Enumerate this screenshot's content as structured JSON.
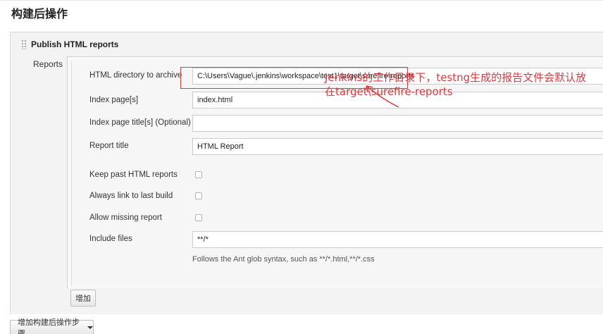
{
  "section": {
    "title": "构建后操作"
  },
  "step": {
    "title": "Publish HTML reports",
    "reports_label": "Reports"
  },
  "fields": {
    "html_dir": {
      "label": "HTML directory to archive",
      "value": "C:\\Users\\Vague\\.jenkins\\workspace\\test1\\target\\surefire-reports"
    },
    "index_pages": {
      "label": "Index page[s]",
      "value": "index.html"
    },
    "index_titles": {
      "label": "Index page title[s] (Optional)",
      "value": ""
    },
    "report_title": {
      "label": "Report title",
      "value": "HTML Report"
    },
    "keep_past": {
      "label": "Keep past HTML reports",
      "checked": false
    },
    "always_link": {
      "label": "Always link to last build",
      "checked": false
    },
    "allow_missing": {
      "label": "Allow missing report",
      "checked": false
    },
    "include_files": {
      "label": "Include files",
      "value": "**/*",
      "help": "Follows the Ant glob syntax, such as **/*.html,**/*.css"
    }
  },
  "annotation": {
    "line1": "Jenkins的工作目录下，testng生成的报告文件会默认放",
    "line2": "在target\\surefire-reports",
    "color": "#e0393e"
  },
  "buttons": {
    "add": "增加",
    "add_post_build_step": "增加构建后操作步骤"
  }
}
